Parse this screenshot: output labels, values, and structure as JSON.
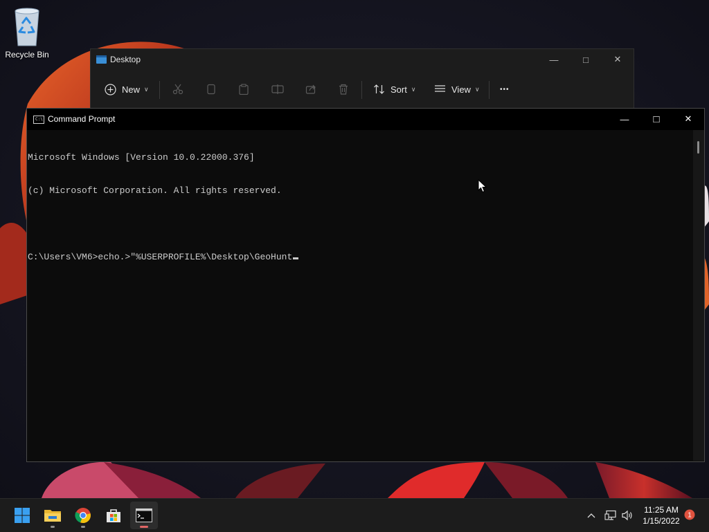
{
  "desktop": {
    "recycle_bin_label": "Recycle Bin"
  },
  "explorer": {
    "title": "Desktop",
    "toolbar": {
      "new_label": "New",
      "sort_label": "Sort",
      "view_label": "View",
      "more_label": "•••"
    },
    "window_buttons": {
      "minimize": "—",
      "maximize": "□",
      "close": "✕"
    }
  },
  "cmd": {
    "title": "Command Prompt",
    "icon_text": "C:\\",
    "lines": [
      "Microsoft Windows [Version 10.0.22000.376]",
      "(c) Microsoft Corporation. All rights reserved.",
      "",
      "C:\\Users\\VM6>echo.>\"%USERPROFILE%\\Desktop\\GeoHunt"
    ],
    "window_buttons": {
      "minimize": "—",
      "maximize": "□",
      "close": "✕"
    }
  },
  "taskbar": {
    "apps": [
      "start-icon",
      "file-explorer-icon",
      "chrome-icon",
      "microsoft-store-icon",
      "command-prompt-icon"
    ],
    "clock_time": "11:25 AM",
    "clock_date": "1/15/2022",
    "notification_count": "1"
  },
  "colors": {
    "taskbar": "#1c1c1c",
    "console_bg": "#0c0c0c",
    "console_fg": "#cccccc",
    "notification_badge": "#e0533f",
    "accent_blue": "#3a8fd6"
  }
}
